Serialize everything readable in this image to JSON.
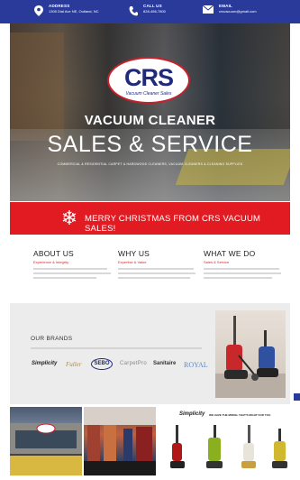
{
  "topbar": {
    "address_label": "ADDRESS",
    "address_value": "1305 Dial Ave NE, Outland, NC",
    "call_label": "CALL US",
    "call_value": "828-456-7800",
    "email_label": "EMAIL",
    "email_value": "crsvacuum@gmail.com"
  },
  "hero": {
    "logo_text": "CRS",
    "logo_sub": "Vacuum Cleaner Sales",
    "title": "VACUUM CLEANER",
    "subtitle": "SALES & SERVICE",
    "tagline": "COMMERCIAL & RESIDENTIAL CARPET & HARDWOOD CLEANERS, VACUUM CLEANERS & CLEANING SUPPLIES"
  },
  "banner": {
    "text": "MERRY CHRISTMAS FROM CRS VACUUM SALES!"
  },
  "columns": [
    {
      "title": "ABOUT US",
      "sub": "Experience & Integrity"
    },
    {
      "title": "WHY US",
      "sub": "Expertise & Value"
    },
    {
      "title": "WHAT WE DO",
      "sub": "Sales & Service"
    }
  ],
  "brands": {
    "heading": "OUR BRANDS",
    "items": [
      "Simplicity",
      "Fuller",
      "SEBO",
      "CarpetPro",
      "Sanitaire",
      "ROYAL"
    ]
  },
  "promo": {
    "brand": "Simplicity",
    "text": "WE HAVE THE MODEL THAT'S RIGHT FOR YOU."
  },
  "colors": {
    "topbar": "#2a3a9a",
    "banner": "#e21b23",
    "accent": "#cc2b2b"
  }
}
